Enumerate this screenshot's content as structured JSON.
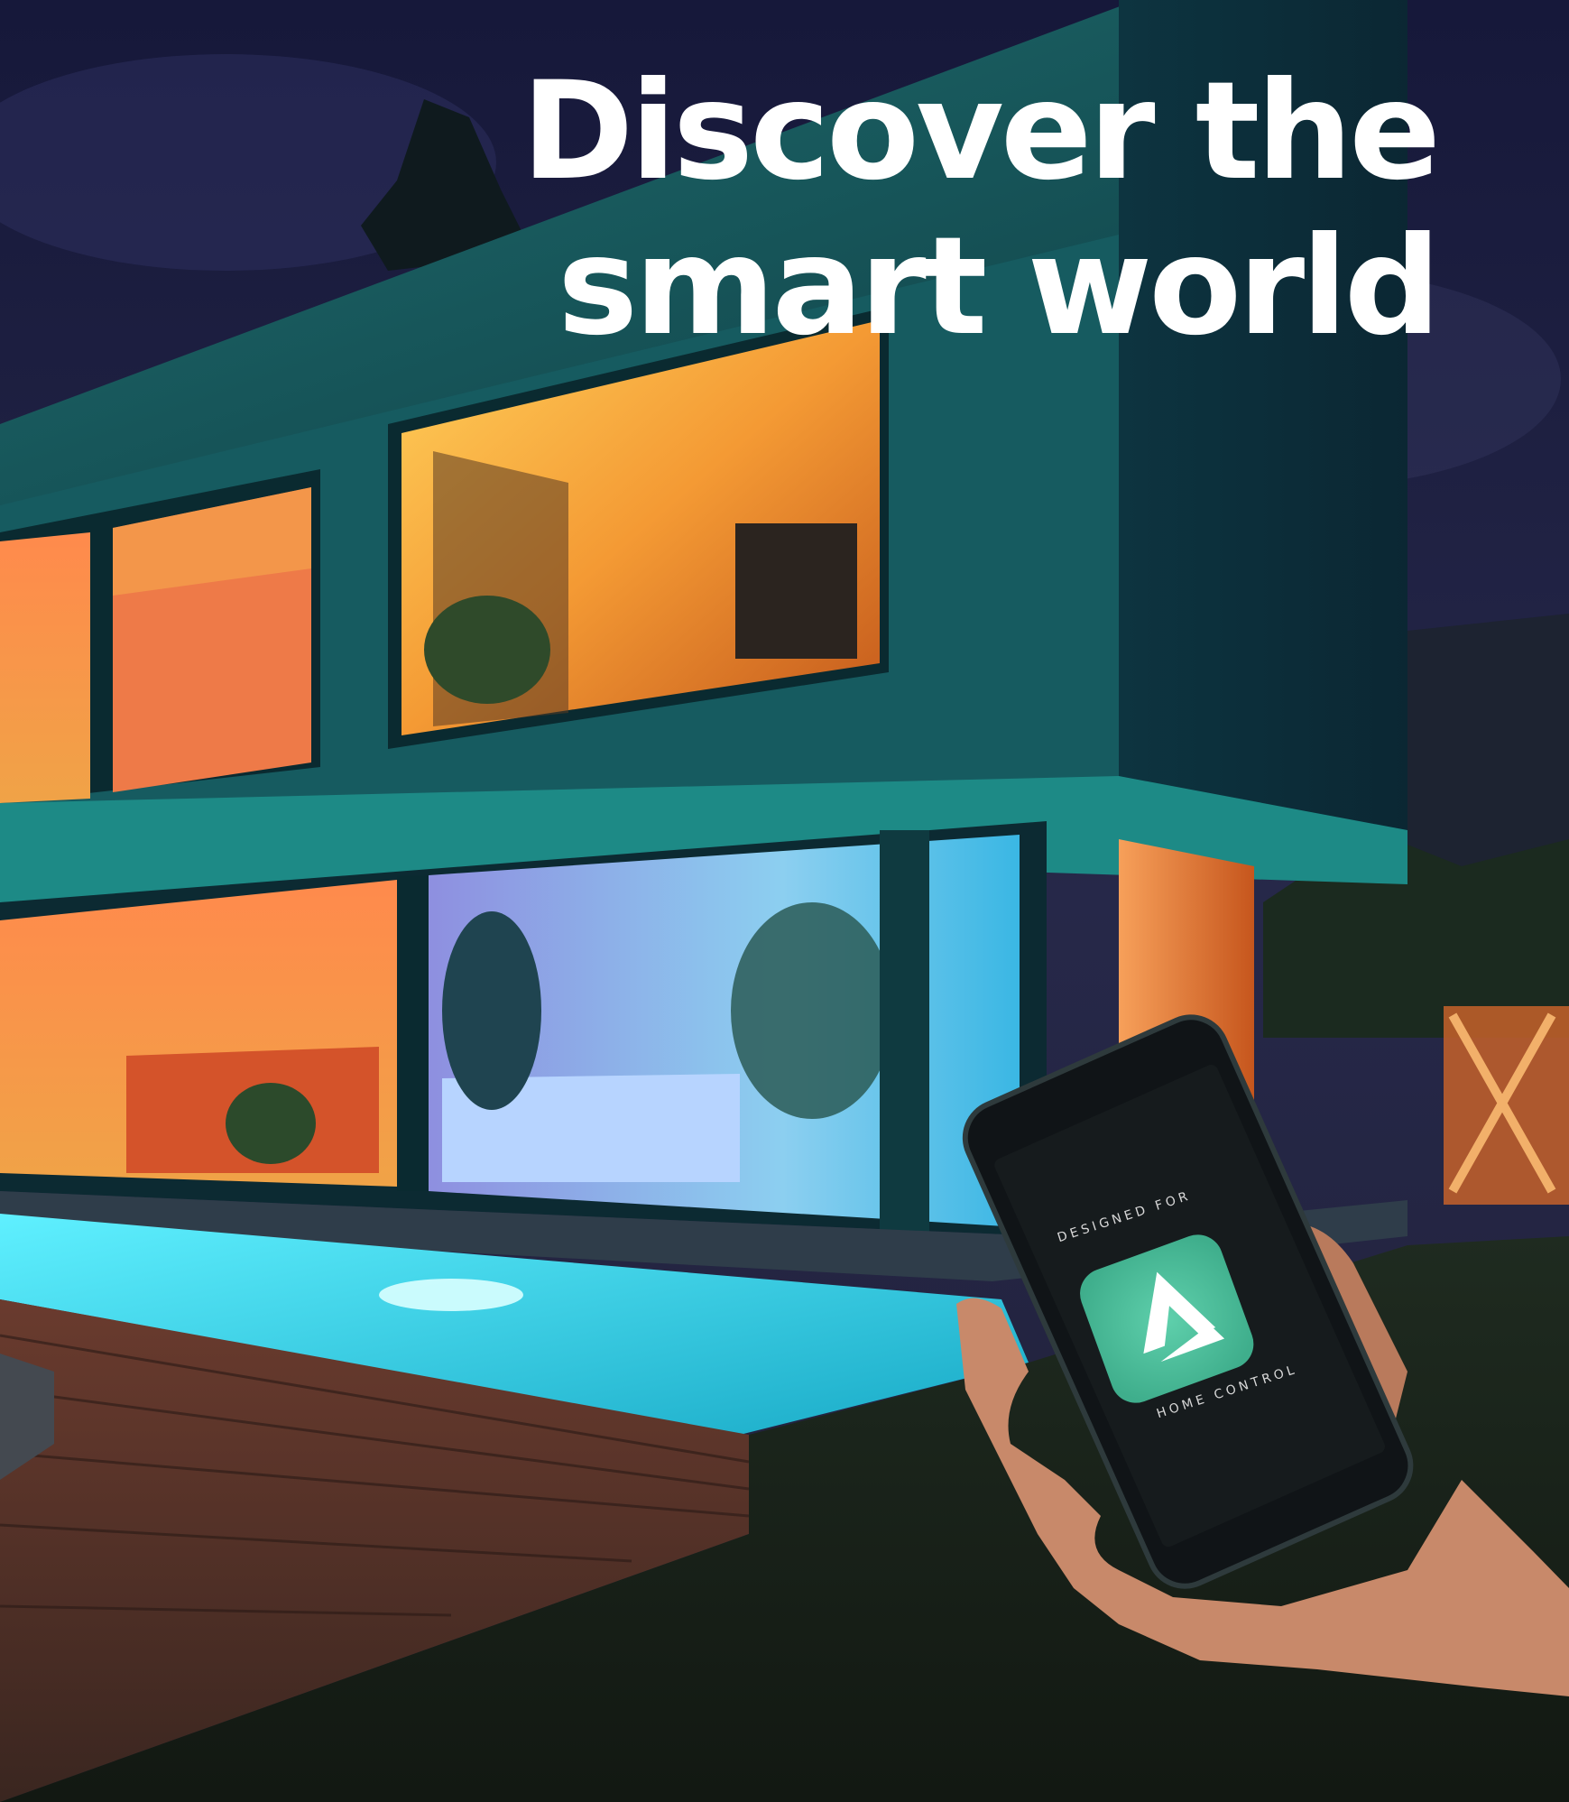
{
  "headline": {
    "line1": "Discover the",
    "line2": "smart world"
  },
  "phone": {
    "top_text": "DESIGNED FOR",
    "bottom_text": "HOME CONTROL",
    "app_icon": "home-control-app-icon",
    "app_icon_color": "#4fbf9c"
  }
}
